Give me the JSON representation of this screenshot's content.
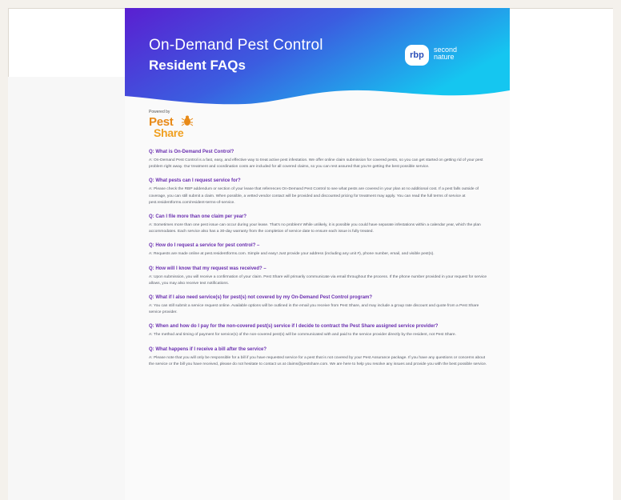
{
  "header": {
    "title_line1": "On-Demand Pest Control",
    "title_line2": "Resident FAQs",
    "logo_rbp": "rbp",
    "logo_partner": "second nature"
  },
  "powered_by": {
    "label": "Powered by",
    "brand_line1": "Pest",
    "brand_line2": "Share"
  },
  "colors": {
    "gradient_start": "#5a1fd1",
    "gradient_mid": "#3b5de0",
    "gradient_end": "#15c6f0",
    "question": "#6a2fb0",
    "answer": "#555a66",
    "brand_orange": "#e88a18"
  },
  "faqs": [
    {
      "q": "Q: What is On-Demand Pest Control?",
      "a": "A: On-Demand Pest Control is a fast, easy, and effective way to treat active pest infestation. We offer online claim submission for covered pests, so you can get started on getting rid of your pest problem right away. Our treatment and coordination costs are included for all covered claims, so you can rest assured that you're getting the best possible service."
    },
    {
      "q": "Q: What pests can I request service for?",
      "a": "A: Please check the RBP addendum or section of your lease that references On-Demand Pest Control to see what pests are covered in your plan at no additional cost. If a pest falls outside of coverage, you can still submit a claim. When possible, a vetted vendor contact will be provided and discounted pricing for treatment may apply. You can read the full terms of service at pest.residentforms.com/resident-terms-of-service."
    },
    {
      "q": "Q: Can I file more than one claim per year?",
      "a": "A: Sometimes more than one pest issue can occur during your lease. That's no problem! While unlikely, it is possible you could have separate infestations within a calendar year, which the plan accommodates. Each service also has a 30-day warranty from the completion of service date to ensure each issue is fully treated."
    },
    {
      "q": "Q: How do I request a service for pest control? –",
      "a": "A: Requests are made online at pest.residentforms.com. Simple and easy! Just provide your address (including any unit #), phone number, email, and visible pest(s)."
    },
    {
      "q": "Q: How will I know that my request was received? –",
      "a": "A: Upon submission, you will receive a confirmation of your claim. Pest Share will primarily communicate via email throughout the process. If the phone number provided in your request for service allows, you may also receive text notifications."
    },
    {
      "q": "Q: What if I also need service(s) for pest(s) not covered by my On-Demand Pest Control program?",
      "a": "A: You can still submit a service request online. Available options will be outlined in the email you receive from Pest Share, and may include a group rate discount and quote from a Pest Share service provider."
    },
    {
      "q": "Q: When and how do I pay for the non-covered pest(s) service if I decide to contract the Pest Share assigned service provider?",
      "a": "A: The method and timing of payment for service(s) of the non-covered pest(s) will be communicated with and paid to the service provider directly by the resident, not Pest Share."
    },
    {
      "q": "Q: What happens if I receive a bill after the service?",
      "a": "A: Please note that you will only be responsible for a bill if you have requested service for a pest that is not covered by your Pest Assurance package. If you have any questions or concerns about the service or the bill you have received, please do not hesitate to contact us at claims@pestshare.com. We are here to help you resolve any issues and provide you with the best possible service."
    }
  ]
}
